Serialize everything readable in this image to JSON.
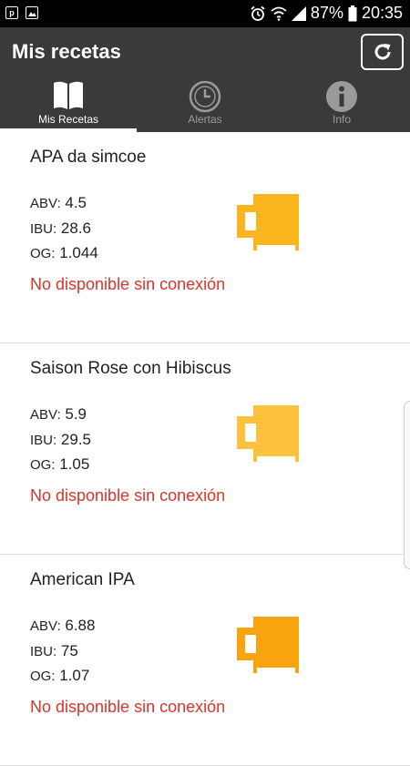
{
  "status_bar": {
    "left_icons": [
      "p-icon",
      "image-icon"
    ],
    "right_icons": [
      "alarm-icon",
      "wifi-icon",
      "signal-icon"
    ],
    "battery": "87%",
    "time": "20:35"
  },
  "app_bar": {
    "title": "Mis recetas",
    "refresh_icon": "refresh-icon"
  },
  "tabs": [
    {
      "label": "Mis Recetas",
      "icon": "book-icon",
      "active": true
    },
    {
      "label": "Alertas",
      "icon": "clock-icon",
      "active": false
    },
    {
      "label": "Info",
      "icon": "info-icon",
      "active": false
    }
  ],
  "recipes": [
    {
      "name": "APA da simcoe",
      "abv_label": "ABV:",
      "abv": "4.5",
      "ibu_label": "IBU:",
      "ibu": "28.6",
      "og_label": "OG:",
      "og": "1.044",
      "status": "No disponible sin conexión",
      "mug_color": "#fbb51f"
    },
    {
      "name": "Saison Rose con Hibiscus",
      "abv_label": "ABV:",
      "abv": "5.9",
      "ibu_label": "IBU:",
      "ibu": "29.5",
      "og_label": "OG:",
      "og": "1.05",
      "status": "No disponible sin conexión",
      "mug_color": "#fdc13c"
    },
    {
      "name": "American IPA",
      "abv_label": "ABV:",
      "abv": "6.88",
      "ibu_label": "IBU:",
      "ibu": "75",
      "og_label": "OG:",
      "og": "1.07",
      "status": "No disponible sin conexión",
      "mug_color": "#f7a40f"
    }
  ],
  "colors": {
    "app_bar": "#3a3a3a",
    "offline_text": "#d9352a"
  }
}
